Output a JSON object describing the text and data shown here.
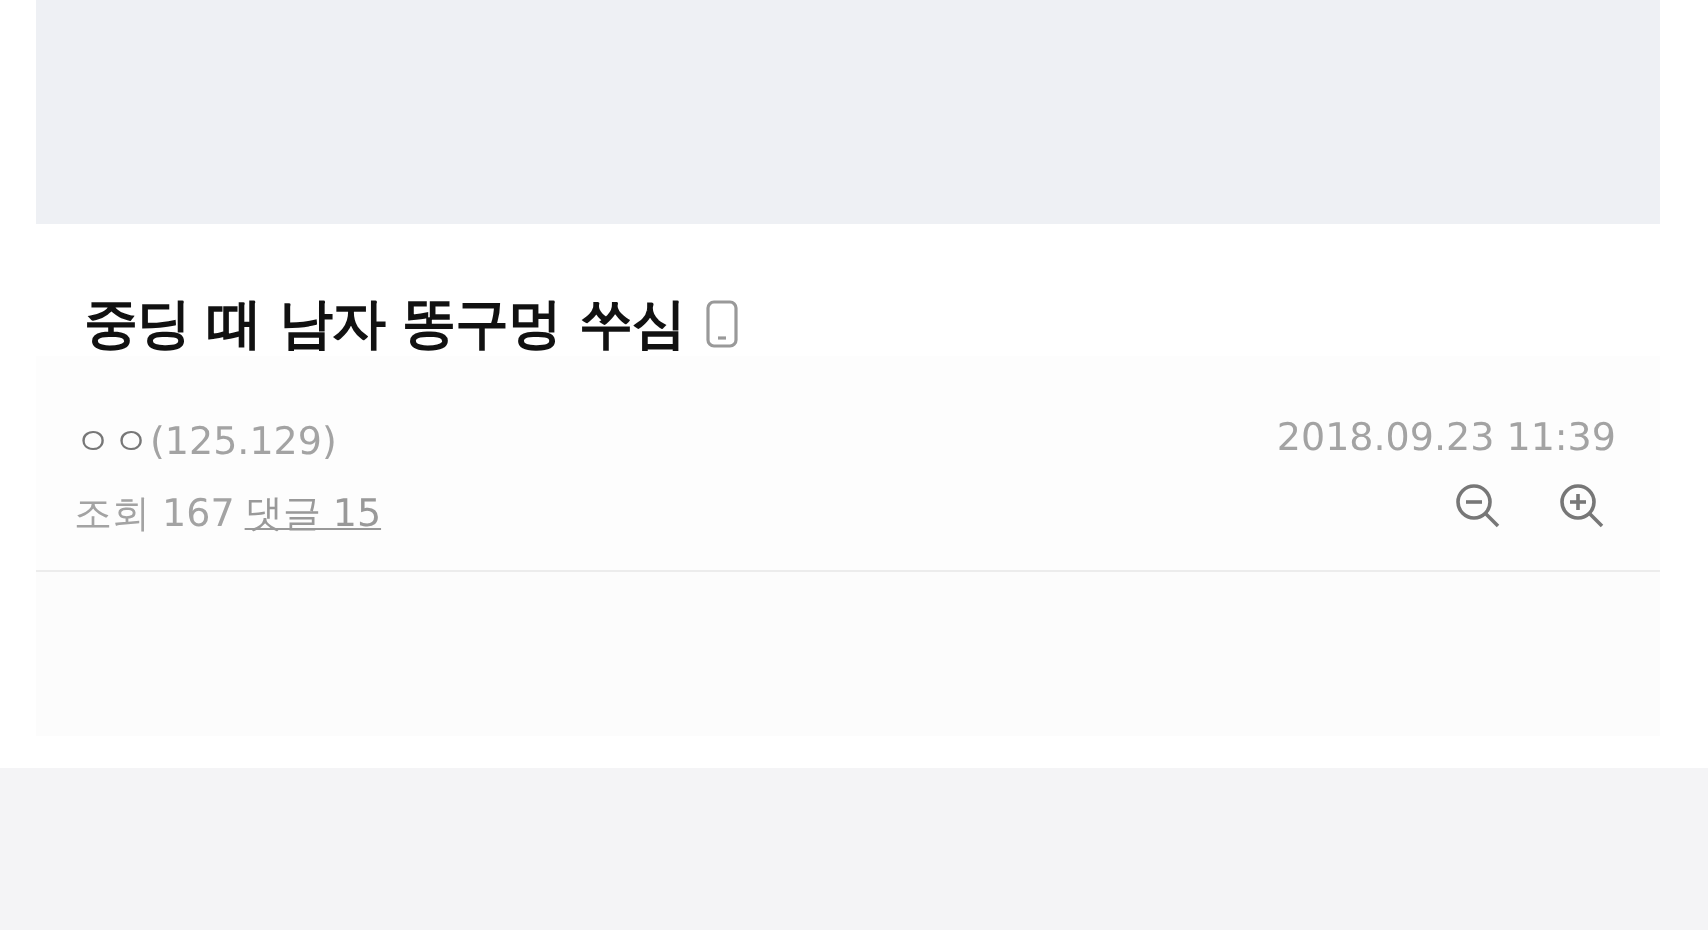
{
  "post": {
    "title": "중딩 때 남자 똥구멍 쑤심",
    "author": "ㅇㅇ",
    "ip": "(125.129)",
    "datetime": "2018.09.23 11:39",
    "views_label": "조회 167",
    "comments_link": "댓글 15"
  }
}
